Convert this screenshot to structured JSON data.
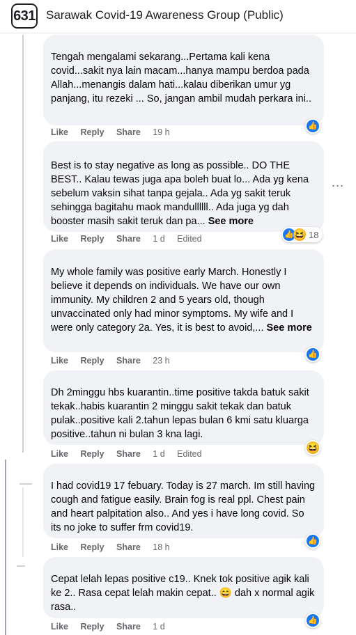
{
  "header": {
    "badge": "631",
    "title": "Sarawak Covid-19 Awareness Group (Public)"
  },
  "actions": {
    "like": "Like",
    "reply": "Reply",
    "share": "Share",
    "edited": "Edited"
  },
  "comments": [
    {
      "text": "Tengah mengalami sekarang...Pertama kali kena covid...sakit nya lain macam...hanya mampu berdoa pada Allah...menangis dalam hati...kalau diberikan umur yg panjang, itu rezeki ... So, jangan ambil mudah perkara ini..",
      "see_more": "",
      "time": "19 h",
      "edited": false,
      "reactions": [
        "like-icon"
      ],
      "reaction_count": ""
    },
    {
      "text": "Best is to stay negative as long as possible.. DO THE BEST.. Kalau tewas juga apa boleh buat lo... Ada yg kena sebelum vaksin sihat tanpa gejala.. Ada yg sakit teruk sehingga bagitahu maok mandullllll.. Ada juga yg dah booster masih sakit teruk dan pa...",
      "see_more": "See more",
      "time": "1 d",
      "edited": true,
      "reactions": [
        "like-icon",
        "haha-icon"
      ],
      "reaction_count": "18"
    },
    {
      "text": "My whole family was positive early March. Honestly I believe it depends on individuals. We have our own immunity. My children 2 and 5 years old, though unvaccinated only had minor symptoms. My wife and I were only category 2a. Yes, it is best to avoid,...",
      "see_more": "See more",
      "time": "23 h",
      "edited": false,
      "reactions": [
        "like-icon"
      ],
      "reaction_count": ""
    },
    {
      "text": "Dh 2minggu hbs kuarantin..time positive takda batuk sakit tekak..habis kuarantin 2 minggu sakit tekak dan batuk pulak..positive kali 2.tahun lepas bulan 6 kmi satu kluarga positive..tahun ni bulan 3 kna lagi.",
      "see_more": "",
      "time": "1 d",
      "edited": true,
      "reactions": [
        "haha-icon"
      ],
      "reaction_count": ""
    },
    {
      "text": "I had covid19 17 febuary. Today is 27 march. Im still having cough and fatigue easily. Brain fog is real ppl. Chest pain and heart palpitation also.. And yes i have long covid. So its no joke to suffer frm covid19.",
      "see_more": "",
      "time": "18 h",
      "edited": false,
      "reactions": [
        "like-icon"
      ],
      "reaction_count": ""
    },
    {
      "text": "Cepat lelah lepas positive c19.. Knek tok positive agik kali ke 2.. Rasa cepat lelah makin cepat.. 😄 dah x normal agik rasa..",
      "see_more": "",
      "time": "1 d",
      "edited": false,
      "reactions": [
        "like-icon"
      ],
      "reaction_count": ""
    }
  ],
  "more_menu": "...",
  "colors": {
    "bubble": "#f0f2f5",
    "like_blue": "#1877f2",
    "meta_gray": "#65676b"
  }
}
